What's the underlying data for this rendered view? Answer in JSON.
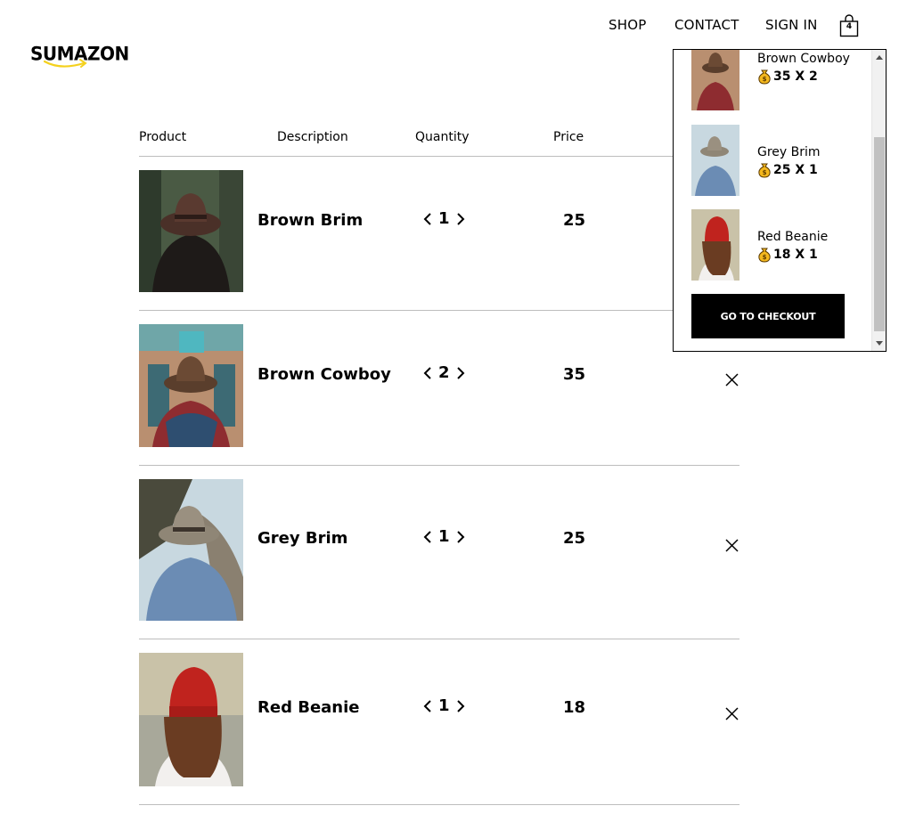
{
  "logo": {
    "text": "SUMAZON"
  },
  "nav": {
    "shop": "SHOP",
    "contact": "CONTACT",
    "sign_in": "SIGN IN",
    "cart_count": "4"
  },
  "table": {
    "headers": {
      "product": "Product",
      "description": "Description",
      "quantity": "Quantity",
      "price": "Price"
    },
    "rows": [
      {
        "name": "Brown Brim",
        "quantity": "1",
        "price": "25"
      },
      {
        "name": "Brown Cowboy",
        "quantity": "2",
        "price": "35"
      },
      {
        "name": "Grey Brim",
        "quantity": "1",
        "price": "25"
      },
      {
        "name": "Red Beanie",
        "quantity": "1",
        "price": "18"
      }
    ]
  },
  "cart_dropdown": {
    "items": [
      {
        "name": "Brown Cowboy",
        "price_qty": "35 X 2"
      },
      {
        "name": "Grey Brim",
        "price_qty": "25 X 1"
      },
      {
        "name": "Red Beanie",
        "price_qty": "18 X 1"
      }
    ],
    "checkout_label": "GO TO CHECKOUT"
  },
  "icons": {
    "cart": "shopping-bag-icon",
    "remove": "close-icon",
    "coin": "money-bag-icon",
    "prev": "chevron-left-icon",
    "next": "chevron-right-icon"
  },
  "colors": {
    "accent": "#f4d11e",
    "text": "#000000",
    "divider": "#bdbdbd",
    "button": "#000000"
  }
}
